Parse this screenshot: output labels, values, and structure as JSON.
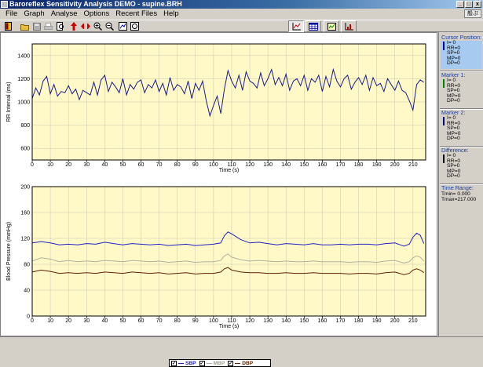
{
  "window": {
    "title": "Baroreflex Sensitivity Analysis DEMO - supine.BRH",
    "minimize": "_",
    "maximize": "□",
    "close": "x"
  },
  "menu": [
    {
      "label": "File",
      "name": "menu-file"
    },
    {
      "label": "Graph",
      "name": "menu-graph"
    },
    {
      "label": "Analyse",
      "name": "menu-analyse"
    },
    {
      "label": "Options",
      "name": "menu-options"
    },
    {
      "label": "Recent Files",
      "name": "menu-recent-files"
    },
    {
      "label": "Help",
      "name": "menu-help"
    }
  ],
  "ime": "般ぷ",
  "toolbar": {
    "icons": [
      "exit-icon",
      "open-icon",
      "save-icon",
      "print-icon",
      "print-preview-icon",
      "arrow-up-icon",
      "arrows-expand-icon",
      "zoom-in-icon",
      "zoom-out-icon",
      "zoom-window-icon",
      "refresh-icon"
    ],
    "view_buttons": [
      "view-chart-icon",
      "view-table-icon",
      "view-graph-icon",
      "view-histogram-icon"
    ]
  },
  "side": {
    "cursor": {
      "title": "Cursor Position:",
      "lines": [
        "I= 0",
        "RR=0",
        "SP=0",
        "MP=0",
        "DP=0"
      ],
      "color": "#0000a0"
    },
    "marker1": {
      "title": "Marker 1:",
      "lines": [
        "I= 0",
        "RR=0",
        "SP=0",
        "MP=0",
        "DP=0"
      ],
      "color": "#008000"
    },
    "marker2": {
      "title": "Marker 2:",
      "lines": [
        "I= 0",
        "RR=0",
        "SP=0",
        "MP=0",
        "DP=0"
      ],
      "color": "#000080"
    },
    "difference": {
      "title": "Difference:",
      "lines": [
        "I= 0",
        "RR=0",
        "SP=0",
        "MP=0",
        "DP=0"
      ],
      "color": "#000000"
    },
    "timerange": {
      "title": "Time Range:",
      "tmin": "Tmin= 0.000",
      "tmax": "Tmax=217.000"
    }
  },
  "legend": [
    {
      "label": "SBP",
      "color": "#2020c0",
      "checked": "✓"
    },
    {
      "label": "MBP",
      "color": "#b0b0a0",
      "checked": "✓"
    },
    {
      "label": "DBP",
      "color": "#602000",
      "checked": "✓"
    }
  ],
  "chart_data": [
    {
      "type": "line",
      "ylabel": "RR Interval (ms)",
      "xlabel": "Time (s)",
      "xlim": [
        0,
        217
      ],
      "ylim": [
        500,
        1500
      ],
      "xticks": [
        0,
        10,
        20,
        30,
        40,
        50,
        60,
        70,
        80,
        90,
        100,
        110,
        120,
        130,
        140,
        150,
        160,
        170,
        180,
        190,
        200,
        210
      ],
      "yticks": [
        600,
        800,
        1000,
        1200,
        1400
      ],
      "series": [
        {
          "color": "#1a1a8c",
          "x": [
            0,
            2,
            4,
            6,
            8,
            10,
            12,
            14,
            16,
            18,
            20,
            22,
            24,
            26,
            28,
            30,
            32,
            34,
            36,
            38,
            40,
            42,
            44,
            46,
            48,
            50,
            52,
            54,
            56,
            58,
            60,
            62,
            64,
            66,
            68,
            70,
            72,
            74,
            76,
            78,
            80,
            82,
            84,
            86,
            88,
            90,
            92,
            94,
            96,
            98,
            100,
            102,
            104,
            106,
            108,
            110,
            112,
            114,
            116,
            118,
            120,
            122,
            124,
            126,
            128,
            130,
            132,
            134,
            136,
            138,
            140,
            142,
            144,
            146,
            148,
            150,
            152,
            154,
            156,
            158,
            160,
            162,
            164,
            166,
            168,
            170,
            172,
            174,
            176,
            178,
            180,
            182,
            184,
            186,
            188,
            190,
            192,
            194,
            196,
            198,
            200,
            202,
            204,
            206,
            208,
            210,
            212,
            214,
            216
          ],
          "y": [
            1030,
            1120,
            1060,
            1180,
            1220,
            1070,
            1150,
            1050,
            1090,
            1080,
            1140,
            1070,
            1110,
            1020,
            1100,
            1080,
            1060,
            1170,
            1060,
            1190,
            1230,
            1090,
            1170,
            1130,
            1080,
            1200,
            1060,
            1150,
            1110,
            1170,
            1190,
            1080,
            1150,
            1120,
            1190,
            1090,
            1160,
            1060,
            1210,
            1100,
            1150,
            1130,
            1070,
            1180,
            1030,
            1160,
            1100,
            1180,
            1010,
            880,
            970,
            1050,
            900,
            1110,
            1270,
            1180,
            1120,
            1230,
            1100,
            1260,
            1180,
            1160,
            1120,
            1250,
            1140,
            1200,
            1280,
            1150,
            1210,
            1140,
            1240,
            1100,
            1180,
            1200,
            1140,
            1230,
            1100,
            1200,
            1170,
            1230,
            1090,
            1220,
            1130,
            1280,
            1180,
            1130,
            1200,
            1230,
            1110,
            1170,
            1210,
            1150,
            1230,
            1100,
            1210,
            1140,
            1160,
            1090,
            1200,
            1150,
            1100,
            1180,
            1100,
            1080,
            1010,
            930,
            1150,
            1190,
            1170
          ]
        }
      ]
    },
    {
      "type": "line",
      "ylabel": "Blood Pressure (mmHg)",
      "xlabel": "Time (s)",
      "xlim": [
        0,
        217
      ],
      "ylim": [
        0,
        200
      ],
      "xticks": [
        0,
        10,
        20,
        30,
        40,
        50,
        60,
        70,
        80,
        90,
        100,
        110,
        120,
        130,
        140,
        150,
        160,
        170,
        180,
        190,
        200,
        210
      ],
      "yticks": [
        0,
        40,
        80,
        120,
        160,
        200
      ],
      "series": [
        {
          "name": "SBP",
          "color": "#2020c0",
          "x": [
            0,
            5,
            10,
            15,
            20,
            25,
            30,
            35,
            40,
            45,
            50,
            55,
            60,
            65,
            70,
            75,
            80,
            85,
            90,
            95,
            100,
            104,
            106,
            108,
            110,
            115,
            120,
            125,
            130,
            135,
            140,
            145,
            150,
            155,
            160,
            165,
            170,
            175,
            180,
            185,
            190,
            195,
            200,
            205,
            208,
            210,
            212,
            214,
            216
          ],
          "y": [
            113,
            115,
            113,
            110,
            111,
            110,
            112,
            111,
            114,
            112,
            110,
            112,
            111,
            110,
            111,
            109,
            110,
            111,
            109,
            110,
            111,
            113,
            124,
            130,
            127,
            118,
            113,
            114,
            112,
            110,
            112,
            111,
            110,
            112,
            110,
            110,
            111,
            110,
            111,
            111,
            110,
            112,
            113,
            108,
            111,
            122,
            128,
            125,
            112
          ]
        },
        {
          "name": "MBP",
          "color": "#b0b0a0",
          "x": [
            0,
            5,
            10,
            15,
            20,
            25,
            30,
            35,
            40,
            45,
            50,
            55,
            60,
            65,
            70,
            75,
            80,
            85,
            90,
            95,
            100,
            104,
            106,
            108,
            110,
            115,
            120,
            125,
            130,
            135,
            140,
            145,
            150,
            155,
            160,
            165,
            170,
            175,
            180,
            185,
            190,
            195,
            200,
            205,
            208,
            210,
            212,
            214,
            216
          ],
          "y": [
            85,
            90,
            88,
            84,
            86,
            84,
            85,
            84,
            86,
            85,
            84,
            86,
            85,
            84,
            85,
            83,
            84,
            85,
            83,
            84,
            84,
            86,
            93,
            96,
            91,
            87,
            85,
            86,
            85,
            84,
            85,
            84,
            84,
            85,
            84,
            84,
            84,
            83,
            84,
            84,
            83,
            85,
            86,
            82,
            84,
            90,
            93,
            91,
            85
          ]
        },
        {
          "name": "DBP",
          "color": "#602000",
          "x": [
            0,
            5,
            10,
            15,
            20,
            25,
            30,
            35,
            40,
            45,
            50,
            55,
            60,
            65,
            70,
            75,
            80,
            85,
            90,
            95,
            100,
            104,
            106,
            108,
            110,
            115,
            120,
            125,
            130,
            135,
            140,
            145,
            150,
            155,
            160,
            165,
            170,
            175,
            180,
            185,
            190,
            195,
            200,
            205,
            208,
            210,
            212,
            214,
            216
          ],
          "y": [
            68,
            71,
            69,
            66,
            67,
            66,
            67,
            66,
            68,
            67,
            66,
            68,
            67,
            66,
            67,
            65,
            66,
            67,
            65,
            66,
            66,
            68,
            73,
            75,
            71,
            68,
            67,
            67,
            66,
            66,
            67,
            66,
            66,
            67,
            66,
            66,
            66,
            65,
            66,
            66,
            65,
            67,
            68,
            64,
            66,
            71,
            73,
            71,
            67
          ]
        }
      ]
    }
  ]
}
